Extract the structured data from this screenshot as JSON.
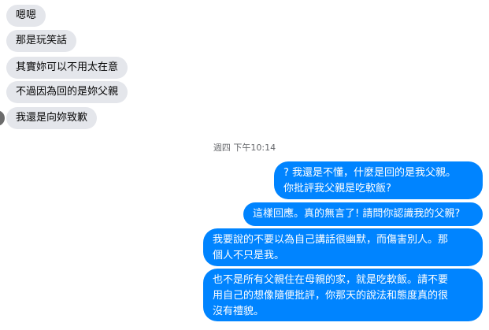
{
  "incoming": [
    "嗯嗯",
    "那是玩笑話",
    "其實妳可以不用太在意",
    "不過因為回的是妳父親",
    "我還是向妳致歉"
  ],
  "timestamp": "週四 下午10:14",
  "outgoing": [
    "? 我還是不懂，什麼是回的是我父親。\n你批評我父親是吃軟飯?",
    "這樣回應。真的無言了! 請問你認識我的父親?",
    "我要說的不要以為自己講話很幽默，而傷害別人。那\n個人不只是我。",
    "也不是所有父親住在母親的家，就是吃軟飯。請不要\n用自己的想像隨便批評，你那天的說法和態度真的很\n沒有禮貌。"
  ],
  "colors": {
    "incoming_bg": "#e4e6eb",
    "outgoing_bg": "#0084ff",
    "outgoing_text": "#ffffff",
    "timestamp_text": "#65676b"
  }
}
